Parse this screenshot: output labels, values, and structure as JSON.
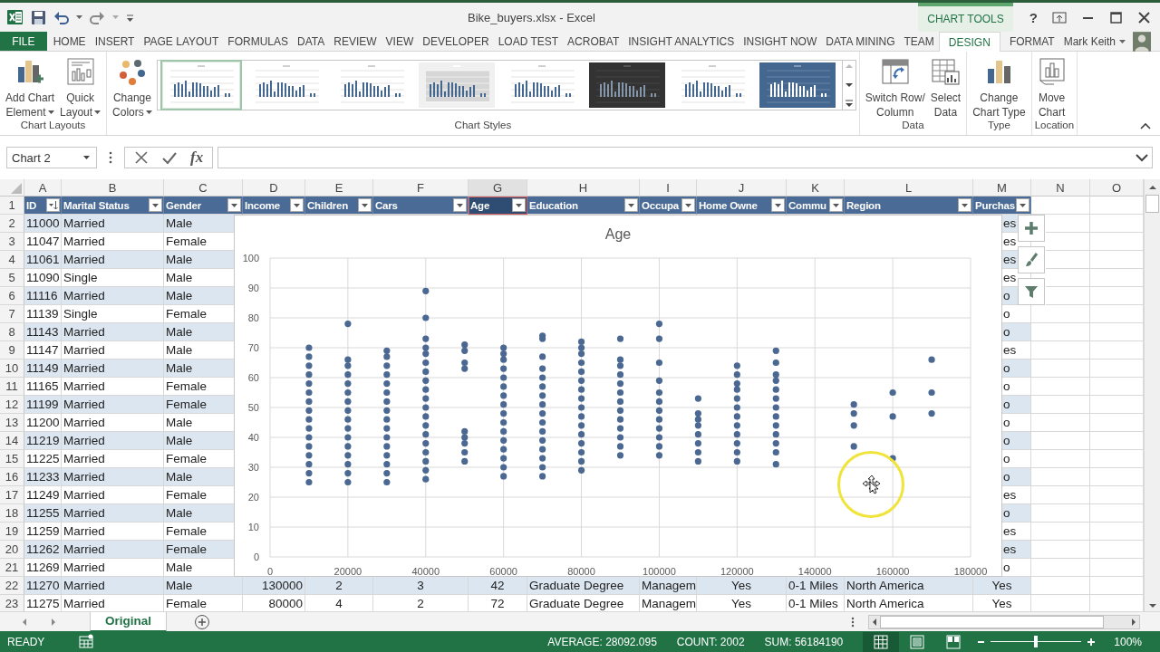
{
  "title_bar": {
    "title": "Bike_buyers.xlsx - Excel",
    "context_header": "CHART TOOLS",
    "help": "?"
  },
  "ribbon_tabs": [
    {
      "label": "FILE",
      "kind": "file",
      "selected": false
    },
    {
      "label": "HOME",
      "kind": "standard",
      "selected": false
    },
    {
      "label": "INSERT",
      "kind": "standard",
      "selected": false
    },
    {
      "label": "PAGE LAYOUT",
      "kind": "standard",
      "selected": false
    },
    {
      "label": "FORMULAS",
      "kind": "standard",
      "selected": false
    },
    {
      "label": "DATA",
      "kind": "standard",
      "selected": false
    },
    {
      "label": "REVIEW",
      "kind": "standard",
      "selected": false
    },
    {
      "label": "VIEW",
      "kind": "standard",
      "selected": false
    },
    {
      "label": "DEVELOPER",
      "kind": "standard",
      "selected": false
    },
    {
      "label": "LOAD TEST",
      "kind": "standard",
      "selected": false
    },
    {
      "label": "ACROBAT",
      "kind": "standard",
      "selected": false
    },
    {
      "label": "INSIGHT ANALYTICS",
      "kind": "standard",
      "selected": false
    },
    {
      "label": "INSIGHT NOW",
      "kind": "standard",
      "selected": false
    },
    {
      "label": "DATA MINING",
      "kind": "standard",
      "selected": false
    },
    {
      "label": "TEAM",
      "kind": "standard",
      "selected": false
    },
    {
      "label": "DESIGN",
      "kind": "context",
      "selected": true
    },
    {
      "label": "FORMAT",
      "kind": "context",
      "selected": false
    }
  ],
  "account": {
    "name": "Mark Keith"
  },
  "ribbon": {
    "groups": [
      {
        "label": "Chart Layouts",
        "kind": "buttons",
        "buttons": [
          {
            "lines": [
              "Add Chart",
              "Element"
            ],
            "kind": "add_element",
            "dropdown": true
          },
          {
            "lines": [
              "Quick",
              "Layout"
            ],
            "kind": "quick_layout",
            "dropdown": true
          }
        ]
      },
      {
        "label": "Chart Styles",
        "kind": "styles",
        "buttons": [
          {
            "lines": [
              "Change",
              "Colors"
            ],
            "kind": "colors",
            "dropdown": true
          }
        ],
        "styles": [
          {
            "kind": "light",
            "selected": true
          },
          {
            "kind": "light",
            "selected": false
          },
          {
            "kind": "light",
            "selected": false
          },
          {
            "kind": "shaded",
            "selected": false
          },
          {
            "kind": "light",
            "selected": false
          },
          {
            "kind": "dark",
            "selected": false
          },
          {
            "kind": "light",
            "selected": false
          },
          {
            "kind": "blue",
            "selected": false
          }
        ]
      },
      {
        "label": "Data",
        "kind": "buttons",
        "buttons": [
          {
            "lines": [
              "Switch Row/",
              "Column"
            ],
            "kind": "switch",
            "dropdown": false
          },
          {
            "lines": [
              "Select",
              "Data"
            ],
            "kind": "select_data",
            "dropdown": false
          }
        ]
      },
      {
        "label": "Type",
        "kind": "buttons",
        "buttons": [
          {
            "lines": [
              "Change",
              "Chart Type"
            ],
            "kind": "chart_type",
            "dropdown": false
          }
        ]
      },
      {
        "label": "Location",
        "kind": "buttons",
        "buttons": [
          {
            "lines": [
              "Move",
              "Chart"
            ],
            "kind": "move_chart",
            "dropdown": false
          }
        ]
      }
    ]
  },
  "formula_bar": {
    "name_box": "Chart 2",
    "insert_function": "fx"
  },
  "sheet": {
    "columns": [
      "A",
      "B",
      "C",
      "D",
      "E",
      "F",
      "G",
      "H",
      "I",
      "J",
      "K",
      "L",
      "M",
      "N",
      "O"
    ],
    "header": {
      "number": "1",
      "cells": [
        {
          "label": "ID",
          "sorted": true,
          "selected": false
        },
        {
          "label": "Marital Status",
          "sorted": false,
          "selected": false
        },
        {
          "label": "Gender",
          "sorted": false,
          "selected": false
        },
        {
          "label": "Income",
          "sorted": false,
          "selected": false
        },
        {
          "label": "Children",
          "sorted": false,
          "selected": false
        },
        {
          "label": "Cars",
          "sorted": false,
          "selected": false
        },
        {
          "label": "Age",
          "sorted": false,
          "selected": true
        },
        {
          "label": "Education",
          "sorted": false,
          "selected": false
        },
        {
          "label": "Occupa",
          "sorted": false,
          "selected": false
        },
        {
          "label": "Home Owne",
          "sorted": false,
          "selected": false
        },
        {
          "label": "Commu",
          "sorted": false,
          "selected": false
        },
        {
          "label": "Region",
          "sorted": false,
          "selected": false
        },
        {
          "label": "Purchas",
          "sorted": false,
          "selected": false
        }
      ]
    },
    "rows": [
      {
        "number": "2",
        "kind": "covered",
        "cells": [
          "11000",
          "Married",
          "Male"
        ],
        "column_m": "es"
      },
      {
        "number": "3",
        "kind": "covered",
        "cells": [
          "11047",
          "Married",
          "Female"
        ],
        "column_m": "es"
      },
      {
        "number": "4",
        "kind": "covered",
        "cells": [
          "11061",
          "Married",
          "Male"
        ],
        "column_m": "es"
      },
      {
        "number": "5",
        "kind": "covered",
        "cells": [
          "11090",
          "Single",
          "Male"
        ],
        "column_m": "es"
      },
      {
        "number": "6",
        "kind": "covered",
        "cells": [
          "11116",
          "Married",
          "Male"
        ],
        "column_m": "o"
      },
      {
        "number": "7",
        "kind": "covered",
        "cells": [
          "11139",
          "Single",
          "Female"
        ],
        "column_m": "o"
      },
      {
        "number": "8",
        "kind": "covered",
        "cells": [
          "11143",
          "Married",
          "Male"
        ],
        "column_m": "o"
      },
      {
        "number": "9",
        "kind": "covered",
        "cells": [
          "11147",
          "Married",
          "Male"
        ],
        "column_m": "es"
      },
      {
        "number": "10",
        "kind": "covered",
        "cells": [
          "11149",
          "Married",
          "Male"
        ],
        "column_m": "o"
      },
      {
        "number": "11",
        "kind": "covered",
        "cells": [
          "11165",
          "Married",
          "Female"
        ],
        "column_m": "o"
      },
      {
        "number": "12",
        "kind": "covered",
        "cells": [
          "11199",
          "Married",
          "Female"
        ],
        "column_m": "o"
      },
      {
        "number": "13",
        "kind": "covered",
        "cells": [
          "11200",
          "Married",
          "Male"
        ],
        "column_m": "o"
      },
      {
        "number": "14",
        "kind": "covered",
        "cells": [
          "11219",
          "Married",
          "Male"
        ],
        "column_m": "o"
      },
      {
        "number": "15",
        "kind": "covered",
        "cells": [
          "11225",
          "Married",
          "Female"
        ],
        "column_m": "o"
      },
      {
        "number": "16",
        "kind": "covered",
        "cells": [
          "11233",
          "Married",
          "Male"
        ],
        "column_m": "o"
      },
      {
        "number": "17",
        "kind": "covered",
        "cells": [
          "11249",
          "Married",
          "Female"
        ],
        "column_m": "es"
      },
      {
        "number": "18",
        "kind": "covered",
        "cells": [
          "11255",
          "Married",
          "Male"
        ],
        "column_m": "o"
      },
      {
        "number": "19",
        "kind": "covered",
        "cells": [
          "11259",
          "Married",
          "Female"
        ],
        "column_m": "es"
      },
      {
        "number": "20",
        "kind": "covered",
        "cells": [
          "11262",
          "Married",
          "Female"
        ],
        "column_m": "es"
      },
      {
        "number": "21",
        "kind": "covered",
        "cells": [
          "11269",
          "Married",
          "Male"
        ],
        "column_m": "o"
      },
      {
        "number": "22",
        "kind": "full",
        "cells": [
          "11270",
          "Married",
          "Male",
          "130000",
          "2",
          "3",
          "42",
          "Graduate Degree",
          "Managem",
          "Yes",
          "0-1 Miles",
          "North America",
          "Yes"
        ]
      },
      {
        "number": "23",
        "kind": "full",
        "cells": [
          "11275",
          "Married",
          "Female",
          "80000",
          "4",
          "2",
          "72",
          "Graduate Degree",
          "Managem",
          "Yes",
          "0-1 Miles",
          "North America",
          "Yes"
        ]
      }
    ]
  },
  "chart": {
    "chart_data": {
      "type": "scatter",
      "title": "Age",
      "x": [
        10000,
        10000,
        10000,
        10000,
        10000,
        10000,
        10000,
        10000,
        10000,
        10000,
        10000,
        10000,
        10000,
        10000,
        10000,
        10000,
        20000,
        20000,
        20000,
        20000,
        20000,
        20000,
        20000,
        20000,
        20000,
        20000,
        20000,
        20000,
        20000,
        20000,
        20000,
        20000,
        30000,
        30000,
        30000,
        30000,
        30000,
        30000,
        30000,
        30000,
        30000,
        30000,
        30000,
        30000,
        30000,
        30000,
        30000,
        30000,
        40000,
        40000,
        40000,
        40000,
        40000,
        40000,
        40000,
        40000,
        40000,
        40000,
        40000,
        40000,
        40000,
        40000,
        40000,
        40000,
        40000,
        40000,
        40000,
        50000,
        50000,
        50000,
        50000,
        50000,
        50000,
        50000,
        50000,
        50000,
        60000,
        60000,
        60000,
        60000,
        60000,
        60000,
        60000,
        60000,
        60000,
        60000,
        60000,
        60000,
        60000,
        60000,
        60000,
        60000,
        70000,
        70000,
        70000,
        70000,
        70000,
        70000,
        70000,
        70000,
        70000,
        70000,
        70000,
        70000,
        70000,
        70000,
        70000,
        70000,
        80000,
        80000,
        80000,
        80000,
        80000,
        80000,
        80000,
        80000,
        80000,
        80000,
        80000,
        80000,
        80000,
        80000,
        80000,
        80000,
        90000,
        90000,
        90000,
        90000,
        90000,
        90000,
        90000,
        90000,
        90000,
        90000,
        90000,
        90000,
        90000,
        100000,
        100000,
        100000,
        100000,
        100000,
        100000,
        100000,
        100000,
        100000,
        100000,
        100000,
        100000,
        110000,
        110000,
        110000,
        110000,
        110000,
        110000,
        110000,
        110000,
        120000,
        120000,
        120000,
        120000,
        120000,
        120000,
        120000,
        120000,
        120000,
        120000,
        120000,
        120000,
        130000,
        130000,
        130000,
        130000,
        130000,
        130000,
        130000,
        130000,
        130000,
        130000,
        130000,
        130000,
        130000,
        150000,
        150000,
        150000,
        150000,
        160000,
        160000,
        160000,
        170000,
        170000,
        170000
      ],
      "series": [
        {
          "color": "#4a6891",
          "values": [
            25,
            28,
            31,
            34,
            37,
            40,
            43,
            46,
            49,
            52,
            55,
            58,
            61,
            64,
            67,
            70,
            25,
            28,
            31,
            34,
            37,
            40,
            43,
            46,
            49,
            52,
            55,
            58,
            61,
            64,
            66,
            78,
            25,
            28,
            31,
            34,
            37,
            40,
            43,
            46,
            49,
            52,
            55,
            58,
            61,
            64,
            67,
            69,
            26,
            29,
            32,
            35,
            38,
            41,
            44,
            47,
            50,
            53,
            56,
            59,
            62,
            65,
            68,
            70,
            73,
            80,
            89,
            32,
            35,
            38,
            40,
            42,
            63,
            65,
            69,
            71,
            27,
            30,
            33,
            36,
            39,
            42,
            45,
            48,
            51,
            54,
            57,
            60,
            63,
            66,
            68,
            70,
            27,
            30,
            33,
            36,
            39,
            42,
            45,
            48,
            51,
            54,
            57,
            60,
            63,
            67,
            73,
            74,
            29,
            32,
            35,
            38,
            41,
            44,
            47,
            50,
            53,
            56,
            59,
            62,
            65,
            68,
            70,
            72,
            34,
            37,
            40,
            43,
            46,
            49,
            52,
            55,
            58,
            61,
            64,
            66,
            73,
            34,
            37,
            40,
            43,
            46,
            49,
            52,
            55,
            59,
            65,
            73,
            78,
            32,
            35,
            38,
            41,
            44,
            46,
            48,
            53,
            32,
            35,
            38,
            41,
            44,
            47,
            50,
            53,
            56,
            58,
            61,
            64,
            31,
            35,
            38,
            41,
            44,
            47,
            50,
            53,
            56,
            59,
            61,
            65,
            69,
            37,
            44,
            48,
            51,
            33,
            47,
            55,
            48,
            55,
            66
          ]
        }
      ],
      "xlim": [
        0,
        180000
      ],
      "ylim": [
        0,
        100
      ],
      "grid": true,
      "xticks": [
        0,
        20000,
        40000,
        60000,
        80000,
        100000,
        120000,
        140000,
        160000,
        180000
      ],
      "yticks": [
        0,
        10,
        20,
        30,
        40,
        50,
        60,
        70,
        80,
        90,
        100
      ]
    }
  },
  "sheet_tabs": [
    {
      "label": "Original",
      "selected": true
    }
  ],
  "status_bar": {
    "mode": "READY",
    "average": "AVERAGE: 28092.095",
    "count": "COUNT: 2002",
    "sum": "SUM: 56184190",
    "views": [
      {
        "kind": "normal",
        "selected": true
      },
      {
        "kind": "page_layout",
        "selected": false
      },
      {
        "kind": "page_break",
        "selected": false
      }
    ],
    "zoom": {
      "level": 0.5,
      "reading": "100%"
    }
  }
}
